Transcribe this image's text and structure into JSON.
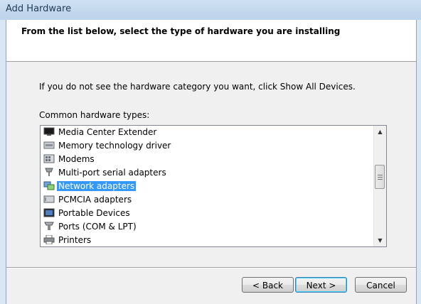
{
  "window": {
    "title": "Add Hardware"
  },
  "header": {
    "title": "From the list below, select the type of hardware you are installing"
  },
  "instruction": "If you do not see the hardware category you want, click Show All Devices.",
  "list_label": "Common hardware types:",
  "list": {
    "items": [
      {
        "label": "Media Center Extender",
        "icon": "media-center-extender-icon",
        "selected": false
      },
      {
        "label": "Memory technology driver",
        "icon": "memory-card-icon",
        "selected": false
      },
      {
        "label": "Modems",
        "icon": "modem-icon",
        "selected": false
      },
      {
        "label": "Multi-port serial adapters",
        "icon": "serial-port-icon",
        "selected": false
      },
      {
        "label": "Network adapters",
        "icon": "network-adapter-icon",
        "selected": true
      },
      {
        "label": "PCMCIA adapters",
        "icon": "pcmcia-card-icon",
        "selected": false
      },
      {
        "label": "Portable Devices",
        "icon": "portable-device-icon",
        "selected": false
      },
      {
        "label": "Ports (COM & LPT)",
        "icon": "port-connector-icon",
        "selected": false
      },
      {
        "label": "Printers",
        "icon": "printer-icon",
        "selected": false
      }
    ],
    "selection_color": "#3399ff"
  },
  "buttons": {
    "back": "< Back",
    "next": "Next >",
    "cancel": "Cancel"
  }
}
